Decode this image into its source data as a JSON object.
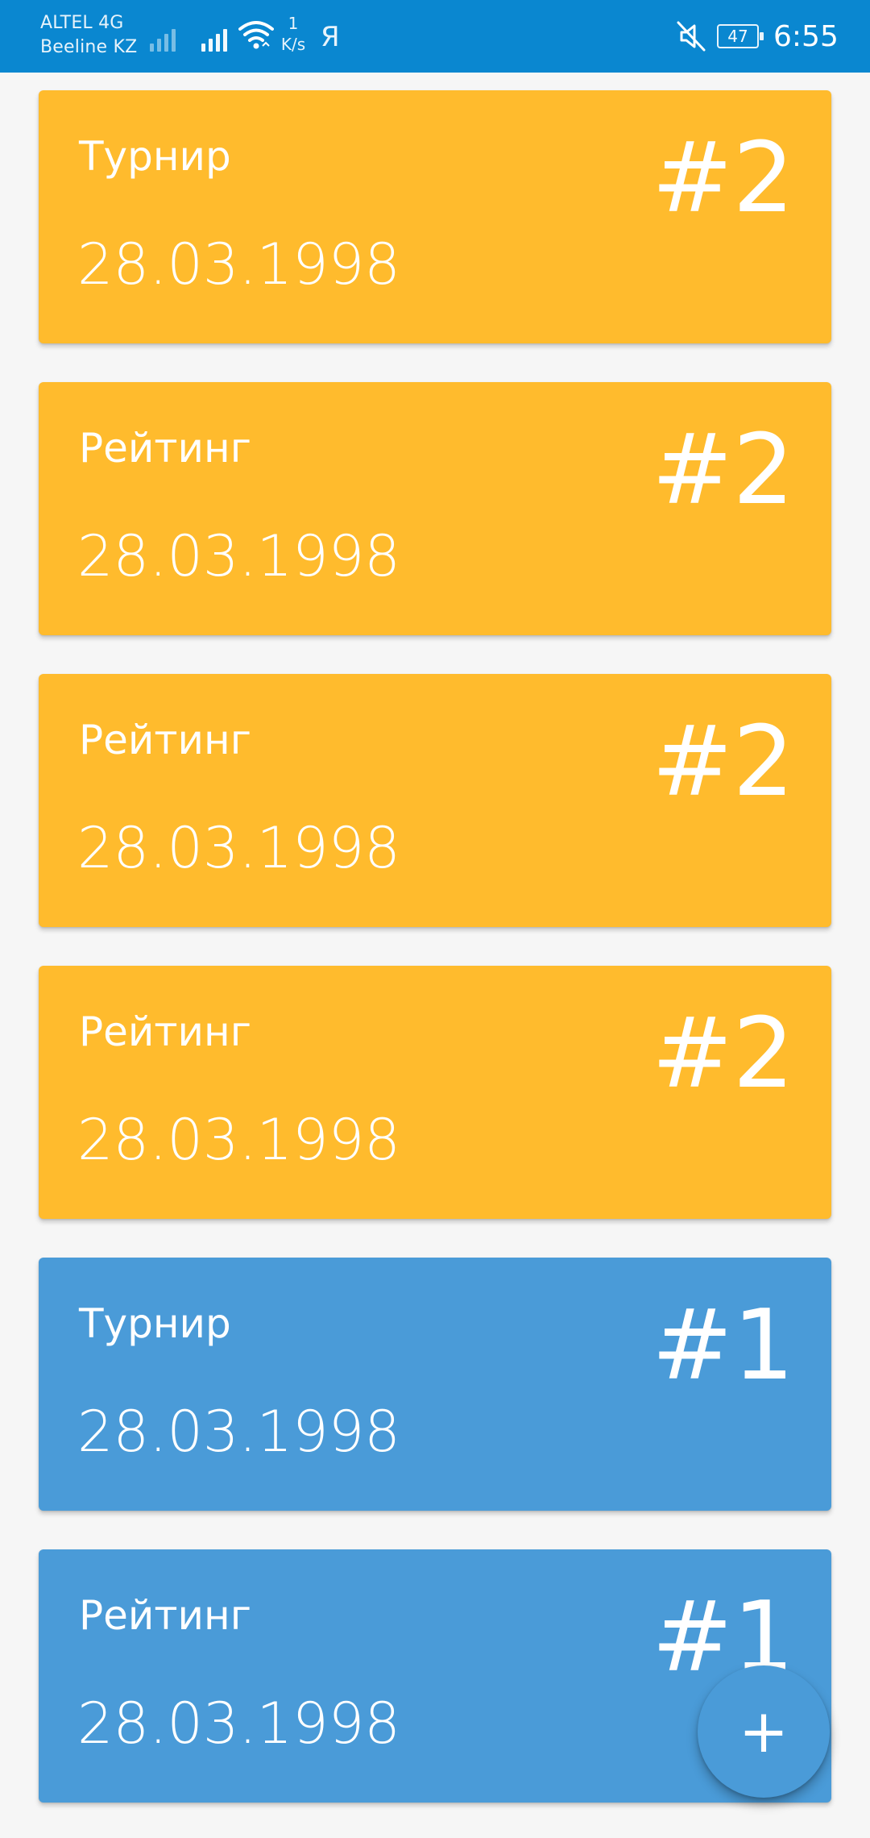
{
  "status_bar": {
    "carrier_1": "ALTEL 4G",
    "carrier_2": "Beeline KZ",
    "speed_value": "1",
    "speed_unit": "K/s",
    "app_letter": "Я",
    "battery": "47",
    "time": "6:55"
  },
  "colors": {
    "status_bar": "#0a87d0",
    "card_yellow": "#ffbb2d",
    "card_blue": "#4a9bd8",
    "fab": "#4a9bd8",
    "background": "#f6f6f6"
  },
  "cards": [
    {
      "type": "Турнир",
      "date": "28.03.1998",
      "rank": "#2",
      "color": "#ffbb2d"
    },
    {
      "type": "Рейтинг",
      "date": "28.03.1998",
      "rank": "#2",
      "color": "#ffbb2d"
    },
    {
      "type": "Рейтинг",
      "date": "28.03.1998",
      "rank": "#2",
      "color": "#ffbb2d"
    },
    {
      "type": "Рейтинг",
      "date": "28.03.1998",
      "rank": "#2",
      "color": "#ffbb2d"
    },
    {
      "type": "Турнир",
      "date": "28.03.1998",
      "rank": "#1",
      "color": "#4a9bd8"
    },
    {
      "type": "Рейтинг",
      "date": "28.03.1998",
      "rank": "#1",
      "color": "#4a9bd8"
    }
  ],
  "fab": {
    "label": "+",
    "icon": "plus-icon"
  }
}
